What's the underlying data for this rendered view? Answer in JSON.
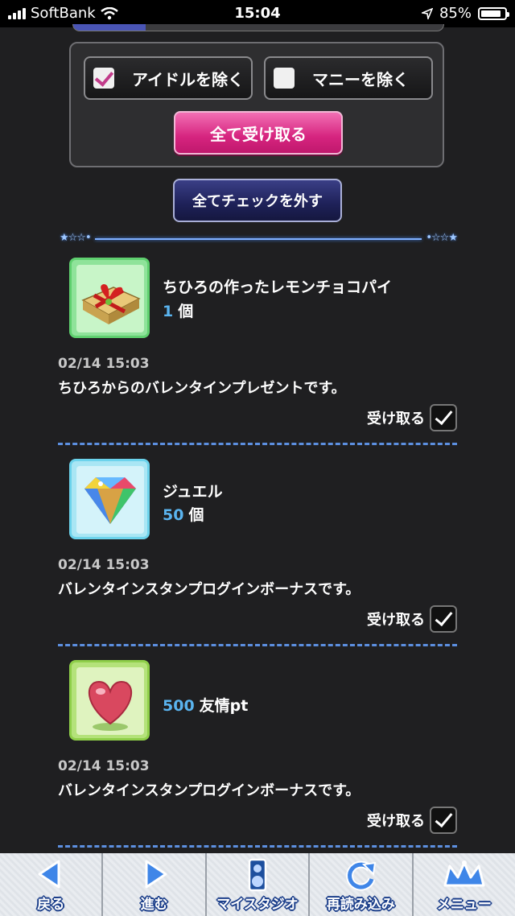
{
  "status_bar": {
    "carrier": "SoftBank",
    "time": "15:04",
    "battery": "85%",
    "battery_level": 0.85
  },
  "filters": {
    "exclude_idol": {
      "label": "アイドルを除く",
      "checked": true
    },
    "exclude_money": {
      "label": "マニーを除く",
      "checked": false
    },
    "receive_all_label": "全て受け取る",
    "uncheck_all_label": "全てチェックを外す"
  },
  "items": [
    {
      "name": "ちひろの作ったレモンチョコパイ",
      "qty": "1",
      "unit": "個",
      "date": "02/14 15:03",
      "desc": "ちひろからのバレンタインプレゼントです。",
      "receive_label": "受け取る",
      "icon": "gift-box-icon"
    },
    {
      "name": "ジュエル",
      "qty": "50",
      "unit": "個",
      "date": "02/14 15:03",
      "desc": "バレンタインスタンプログインボーナスです。",
      "receive_label": "受け取る",
      "icon": "jewel-icon"
    },
    {
      "name": "友情pt",
      "qty": "500",
      "unit": "",
      "date": "02/14 15:03",
      "desc": "バレンタインスタンプログインボーナスです。",
      "receive_label": "受け取る",
      "icon": "heart-icon"
    }
  ],
  "nav": {
    "back": "戻る",
    "forward": "進む",
    "my_studio": "マイスタジオ",
    "reload": "再読み込み",
    "menu": "メニュー"
  },
  "colors": {
    "accent_pink": "#d6247f",
    "navy": "#1e2158",
    "qty_blue": "#5ab4ef",
    "divider_blue": "#5c8fe0"
  }
}
